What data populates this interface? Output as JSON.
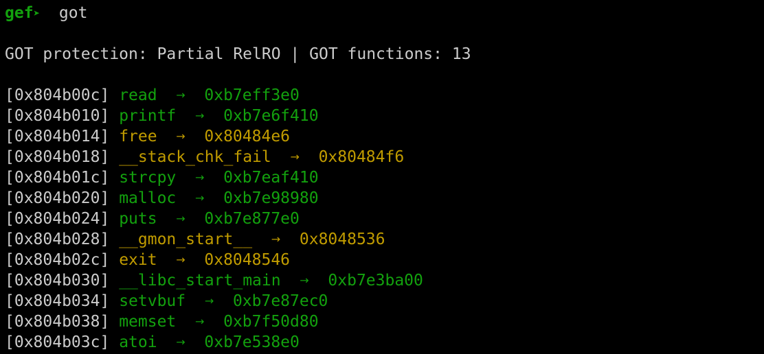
{
  "prompt": {
    "name": "gef",
    "arrow": "➤",
    "command": "got"
  },
  "header": {
    "label_protection": "GOT protection: ",
    "protection_value": "Partial RelRO",
    "separator": " | ",
    "label_functions": "GOT functions: ",
    "functions_count": "13"
  },
  "arrow_glyph": "→",
  "colors": {
    "resolved": "#13a10e",
    "unresolved": "#c19c00",
    "text": "#cccccc",
    "background": "#000000"
  },
  "entries": [
    {
      "address": "[0x804b00c]",
      "name": "read",
      "target": "0xb7eff3e0",
      "resolved": true
    },
    {
      "address": "[0x804b010]",
      "name": "printf",
      "target": "0xb7e6f410",
      "resolved": true
    },
    {
      "address": "[0x804b014]",
      "name": "free",
      "target": "0x80484e6",
      "resolved": false
    },
    {
      "address": "[0x804b018]",
      "name": "__stack_chk_fail",
      "target": "0x80484f6",
      "resolved": false
    },
    {
      "address": "[0x804b01c]",
      "name": "strcpy",
      "target": "0xb7eaf410",
      "resolved": true
    },
    {
      "address": "[0x804b020]",
      "name": "malloc",
      "target": "0xb7e98980",
      "resolved": true
    },
    {
      "address": "[0x804b024]",
      "name": "puts",
      "target": "0xb7e877e0",
      "resolved": true
    },
    {
      "address": "[0x804b028]",
      "name": "__gmon_start__",
      "target": "0x8048536",
      "resolved": false
    },
    {
      "address": "[0x804b02c]",
      "name": "exit",
      "target": "0x8048546",
      "resolved": false
    },
    {
      "address": "[0x804b030]",
      "name": "__libc_start_main",
      "target": "0xb7e3ba00",
      "resolved": true
    },
    {
      "address": "[0x804b034]",
      "name": "setvbuf",
      "target": "0xb7e87ec0",
      "resolved": true
    },
    {
      "address": "[0x804b038]",
      "name": "memset",
      "target": "0xb7f50d80",
      "resolved": true
    },
    {
      "address": "[0x804b03c]",
      "name": "atoi",
      "target": "0xb7e538e0",
      "resolved": true
    }
  ]
}
